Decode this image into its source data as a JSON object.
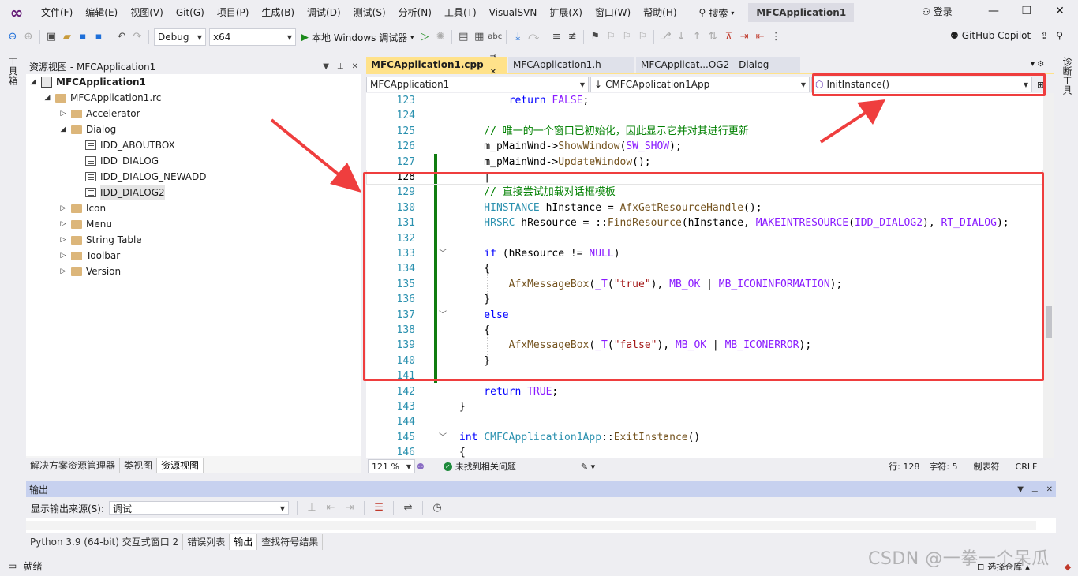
{
  "colors": {
    "accent": "#68217a",
    "annotation": "#ef3e3e",
    "tab_active": "#ffe28a",
    "change_bar": "#107c10"
  },
  "menu": {
    "items": [
      "文件(F)",
      "编辑(E)",
      "视图(V)",
      "Git(G)",
      "项目(P)",
      "生成(B)",
      "调试(D)",
      "测试(S)",
      "分析(N)",
      "工具(T)",
      "VisualSVN",
      "扩展(X)",
      "窗口(W)",
      "帮助(H)"
    ],
    "search_label": "搜索",
    "active_title": "MFCApplication1",
    "login": "登录"
  },
  "toolbar": {
    "config": "Debug",
    "platform": "x64",
    "run_label": "本地 Windows 调试器",
    "copilot": "GitHub Copilot"
  },
  "side": {
    "left_label": "工具箱",
    "right_label": "诊断工具"
  },
  "resource_view": {
    "title": "资源视图 - MFCApplication1",
    "tree": [
      {
        "label": "MFCApplication1",
        "arrow": "◢",
        "icon": "project-icon",
        "bold": true
      },
      {
        "label": "MFCApplication1.rc",
        "arrow": "◢",
        "icon": "rc-file-icon"
      },
      {
        "label": "Accelerator",
        "arrow": "▷",
        "icon": "folder-icon"
      },
      {
        "label": "Dialog",
        "arrow": "◢",
        "icon": "folder-icon"
      },
      {
        "label": "IDD_ABOUTBOX",
        "arrow": "",
        "icon": "dialog-icon"
      },
      {
        "label": "IDD_DIALOG",
        "arrow": "",
        "icon": "dialog-icon"
      },
      {
        "label": "IDD_DIALOG_NEWADD",
        "arrow": "",
        "icon": "dialog-icon"
      },
      {
        "label": "IDD_DIALOG2",
        "arrow": "",
        "icon": "dialog-icon",
        "selected": true
      },
      {
        "label": "Icon",
        "arrow": "▷",
        "icon": "folder-icon"
      },
      {
        "label": "Menu",
        "arrow": "▷",
        "icon": "folder-icon"
      },
      {
        "label": "String Table",
        "arrow": "▷",
        "icon": "folder-icon"
      },
      {
        "label": "Toolbar",
        "arrow": "▷",
        "icon": "folder-icon"
      },
      {
        "label": "Version",
        "arrow": "▷",
        "icon": "folder-icon"
      }
    ],
    "tabs": [
      "解决方案资源管理器",
      "类视图",
      "资源视图"
    ],
    "active_tab": 2
  },
  "editor": {
    "tabs": [
      {
        "label": "MFCApplication1.cpp",
        "active": true,
        "ctl": "⊸ ✕"
      },
      {
        "label": "MFCApplication1.h",
        "active": false,
        "ctl": ""
      },
      {
        "label": "MFCApplicat...OG2 - Dialog",
        "active": false,
        "ctl": ""
      }
    ],
    "nav": {
      "project": "MFCApplication1",
      "class": "CMFCApplication1App",
      "member": "InitInstance()"
    },
    "lines": [
      {
        "n": "123",
        "tokens": [
          [
            "kw",
            "        return "
          ],
          [
            "mac",
            "FALSE"
          ],
          [
            "pl",
            ";"
          ]
        ]
      },
      {
        "n": "124",
        "tokens": []
      },
      {
        "n": "125",
        "tokens": [
          [
            "cm",
            "    // 唯一的一个窗口已初始化，因此显示它并对其进行更新"
          ]
        ]
      },
      {
        "n": "126",
        "tokens": [
          [
            "pl",
            "    m_pMainWnd->"
          ],
          [
            "fn",
            "ShowWindow"
          ],
          [
            "pl",
            "("
          ],
          [
            "mac",
            "SW_SHOW"
          ],
          [
            "pl",
            ");"
          ]
        ]
      },
      {
        "n": "127",
        "tokens": [
          [
            "pl",
            "    m_pMainWnd->"
          ],
          [
            "fn",
            "UpdateWindow"
          ],
          [
            "pl",
            "();"
          ]
        ]
      },
      {
        "n": "128",
        "tokens": [
          [
            "pl",
            "    |"
          ]
        ],
        "current": true
      },
      {
        "n": "129",
        "tokens": [
          [
            "cm",
            "    // 直接尝试加载对话框模板"
          ]
        ]
      },
      {
        "n": "130",
        "tokens": [
          [
            "ty",
            "    HINSTANCE"
          ],
          [
            "pl",
            " hInstance = "
          ],
          [
            "fn",
            "AfxGetResourceHandle"
          ],
          [
            "pl",
            "();"
          ]
        ]
      },
      {
        "n": "131",
        "tokens": [
          [
            "ty",
            "    HRSRC"
          ],
          [
            "pl",
            " hResource = ::"
          ],
          [
            "fn",
            "FindResource"
          ],
          [
            "pl",
            "(hInstance, "
          ],
          [
            "mac",
            "MAKEINTRESOURCE"
          ],
          [
            "pl",
            "("
          ],
          [
            "mac",
            "IDD_DIALOG2"
          ],
          [
            "pl",
            "), "
          ],
          [
            "mac",
            "RT_DIALOG"
          ],
          [
            "pl",
            ");"
          ]
        ]
      },
      {
        "n": "132",
        "tokens": []
      },
      {
        "n": "133",
        "tokens": [
          [
            "kw",
            "    if"
          ],
          [
            "pl",
            " (hResource != "
          ],
          [
            "mac",
            "NULL"
          ],
          [
            "pl",
            ")"
          ]
        ],
        "fold": "﹀"
      },
      {
        "n": "134",
        "tokens": [
          [
            "pl",
            "    {"
          ]
        ]
      },
      {
        "n": "135",
        "tokens": [
          [
            "fn",
            "        AfxMessageBox"
          ],
          [
            "pl",
            "("
          ],
          [
            "mac",
            "_T"
          ],
          [
            "pl",
            "("
          ],
          [
            "str",
            "\"true\""
          ],
          [
            "pl",
            "), "
          ],
          [
            "mac",
            "MB_OK"
          ],
          [
            "pl",
            " | "
          ],
          [
            "mac",
            "MB_ICONINFORMATION"
          ],
          [
            "pl",
            ");"
          ]
        ]
      },
      {
        "n": "136",
        "tokens": [
          [
            "pl",
            "    }"
          ]
        ]
      },
      {
        "n": "137",
        "tokens": [
          [
            "kw",
            "    else"
          ]
        ],
        "fold": "﹀"
      },
      {
        "n": "138",
        "tokens": [
          [
            "pl",
            "    {"
          ]
        ]
      },
      {
        "n": "139",
        "tokens": [
          [
            "fn",
            "        AfxMessageBox"
          ],
          [
            "pl",
            "("
          ],
          [
            "mac",
            "_T"
          ],
          [
            "pl",
            "("
          ],
          [
            "str",
            "\"false\""
          ],
          [
            "pl",
            "), "
          ],
          [
            "mac",
            "MB_OK"
          ],
          [
            "pl",
            " | "
          ],
          [
            "mac",
            "MB_ICONERROR"
          ],
          [
            "pl",
            ");"
          ]
        ]
      },
      {
        "n": "140",
        "tokens": [
          [
            "pl",
            "    }"
          ]
        ]
      },
      {
        "n": "141",
        "tokens": []
      },
      {
        "n": "142",
        "tokens": [
          [
            "kw",
            "    return "
          ],
          [
            "mac",
            "TRUE"
          ],
          [
            "pl",
            ";"
          ]
        ]
      },
      {
        "n": "143",
        "tokens": [
          [
            "pl",
            "}"
          ]
        ]
      },
      {
        "n": "144",
        "tokens": []
      },
      {
        "n": "145",
        "tokens": [
          [
            "kw",
            "int "
          ],
          [
            "ty",
            "CMFCApplication1App"
          ],
          [
            "pl",
            "::"
          ],
          [
            "fn",
            "ExitInstance"
          ],
          [
            "pl",
            "()"
          ]
        ],
        "fold": "﹀"
      },
      {
        "n": "146",
        "tokens": [
          [
            "pl",
            "{"
          ]
        ]
      }
    ],
    "status": {
      "zoom": "121 %",
      "issues": "未找到相关问题",
      "line": "行: 128",
      "col": "字符: 5",
      "tabs": "制表符",
      "eol": "CRLF"
    }
  },
  "output": {
    "title": "输出",
    "source_label": "显示输出来源(S):",
    "source_value": "调试",
    "tabs": [
      "Python 3.9 (64-bit) 交互式窗口 2",
      "错误列表",
      "输出",
      "查找符号结果"
    ],
    "active_tab": 2
  },
  "statusbar": {
    "ready": "就绪",
    "repo": "选择仓库",
    "watermark": "CSDN @一拳一个呆瓜"
  }
}
